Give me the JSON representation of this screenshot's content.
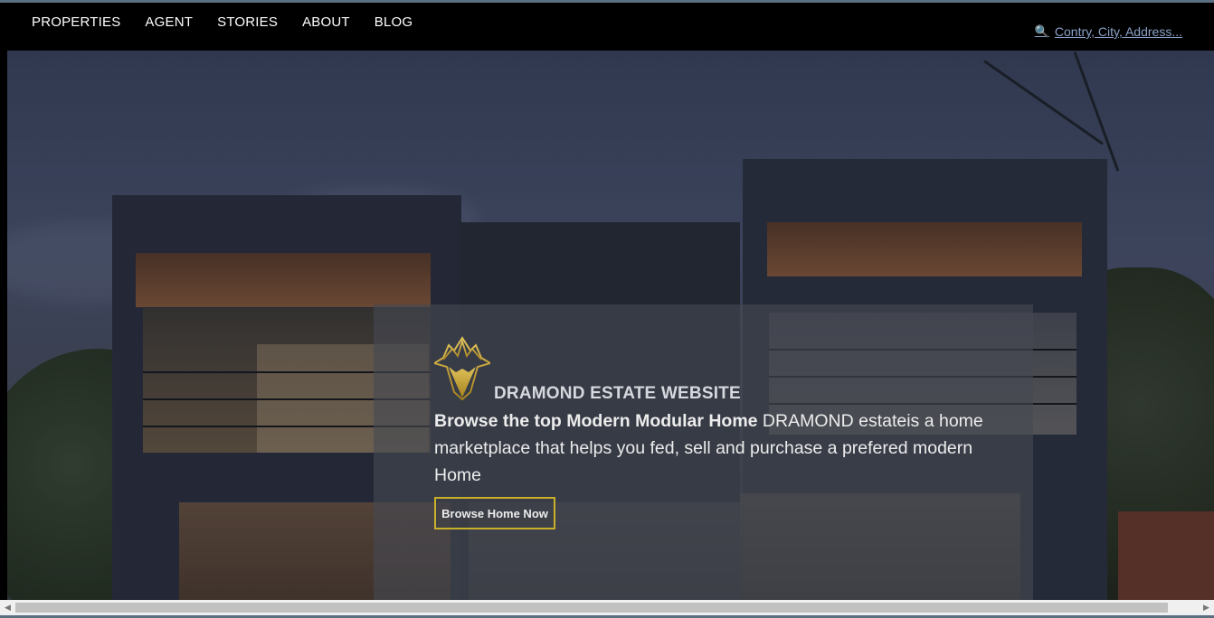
{
  "nav": {
    "items": [
      {
        "label": "PROPERTIES"
      },
      {
        "label": "AGENT"
      },
      {
        "label": "STORIES"
      },
      {
        "label": "ABOUT"
      },
      {
        "label": "BLOG"
      }
    ],
    "search": {
      "icon": "magnifier-icon",
      "label": "Contry, City, Address..."
    }
  },
  "hero": {
    "site_title": "DRAMOND ESTATE WEBSITE",
    "headline_bold": "Browse the top Modern Modular Home",
    "headline_text": " DRAMOND estateis a home marketplace that helps you fed, sell and purchase a prefered modern Home",
    "button_label": "Browse Home Now",
    "logo_icon": "gold-crown-logo",
    "accent_color": "#c8b02a"
  },
  "scrollbar": {
    "left_arrow": "◀",
    "right_arrow": "▶"
  }
}
